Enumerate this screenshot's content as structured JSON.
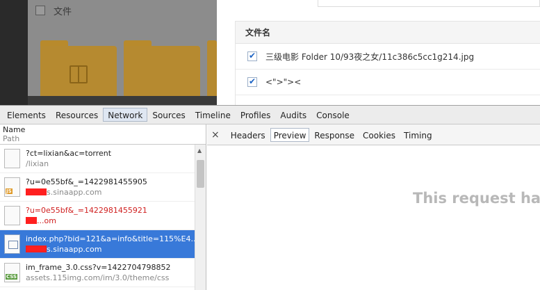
{
  "page": {
    "dim_panel": {
      "row_label": "文件"
    },
    "file_table": {
      "header": "文件名",
      "rows": [
        {
          "name": "三级电影 Folder 10/93夜之女/11c386c5cc1g214.jpg",
          "checked": true
        },
        {
          "name": "<\">\"><",
          "checked": true
        }
      ]
    }
  },
  "devtools": {
    "tabs": [
      "Elements",
      "Resources",
      "Network",
      "Sources",
      "Timeline",
      "Profiles",
      "Audits",
      "Console"
    ],
    "active_tab": "Network",
    "list_header": {
      "name": "Name",
      "path": "Path"
    },
    "requests": [
      {
        "name": "?ct=lixian&ac=torrent",
        "host": "/lixian",
        "icon": "blank-file-icon",
        "type": "doc"
      },
      {
        "name": "?u=0e55bf&_=1422981455905",
        "host": "s.sinaapp.com",
        "icon": "js-file-icon",
        "type": "js"
      },
      {
        "name": "?u=0e55bf&_=1422981455921",
        "host": "...om",
        "icon": "blank-file-icon",
        "type": "error"
      },
      {
        "name": "index.php?bid=121&a=info&title=115%E4...",
        "host": "s.sinaapp.com",
        "icon": "image-file-icon",
        "type": "img"
      },
      {
        "name": "im_frame_3.0.css?v=1422704798852",
        "host": "assets.115img.com/im/3.0/theme/css",
        "icon": "css-file-icon",
        "type": "css"
      }
    ],
    "detail_tabs": [
      "Headers",
      "Preview",
      "Response",
      "Cookies",
      "Timing"
    ],
    "active_detail_tab": "Preview",
    "preview_message": "This request has"
  }
}
